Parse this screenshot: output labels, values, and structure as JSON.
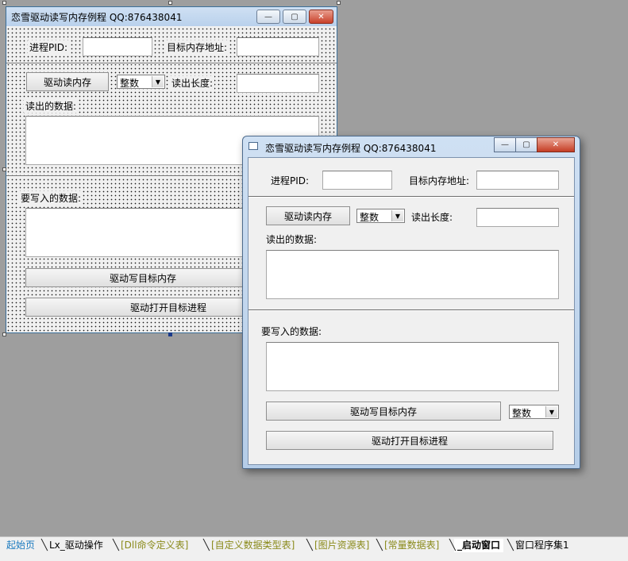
{
  "design_form": {
    "title": "恋雪驱动读写内存例程  QQ:876438041",
    "minimize_glyph": "—",
    "restore_glyph": "▢",
    "close_glyph": "✕",
    "pid_label": "进程PID:",
    "pid_value": "",
    "addr_label": "目标内存地址:",
    "addr_value": "",
    "read_button": "驱动读内存",
    "type_combo": "整数",
    "read_len_label": "读出长度:",
    "read_len_value": "",
    "read_data_label": "读出的数据:",
    "write_data_label": "要写入的数据:",
    "write_button": "驱动写目标内存",
    "open_button": "驱动打开目标进程"
  },
  "preview_window": {
    "title": "恋雪驱动读写内存例程  QQ:876438041",
    "minimize_glyph": "—",
    "restore_glyph": "▢",
    "close_glyph": "✕",
    "pid_label": "进程PID:",
    "addr_label": "目标内存地址:",
    "read_button": "驱动读内存",
    "read_type_combo": "整数",
    "read_len_label": "读出长度:",
    "read_data_label": "读出的数据:",
    "write_data_label": "要写入的数据:",
    "write_button": "驱动写目标内存",
    "write_type_combo": "整数",
    "open_button": "驱动打开目标进程"
  },
  "tabs": [
    {
      "label": "起始页",
      "color": "#1a7abf"
    },
    {
      "label": "Lx_驱动操作",
      "color": "#000000"
    },
    {
      "label": "[Dll命令定义表]",
      "color": "#8a8a1a"
    },
    {
      "label": "[自定义数据类型表]",
      "color": "#8a8a1a"
    },
    {
      "label": "[图片资源表]",
      "color": "#8a8a1a"
    },
    {
      "label": "[常量数据表]",
      "color": "#8a8a1a"
    },
    {
      "label": "_启动窗口",
      "color": "#000000",
      "active": true
    },
    {
      "label": "窗口程序集1",
      "color": "#000000"
    }
  ],
  "colors": {
    "desktop": "#9e9e9e",
    "form_bg": "#f0f0f0",
    "titlebar": "#b9d1ec"
  }
}
